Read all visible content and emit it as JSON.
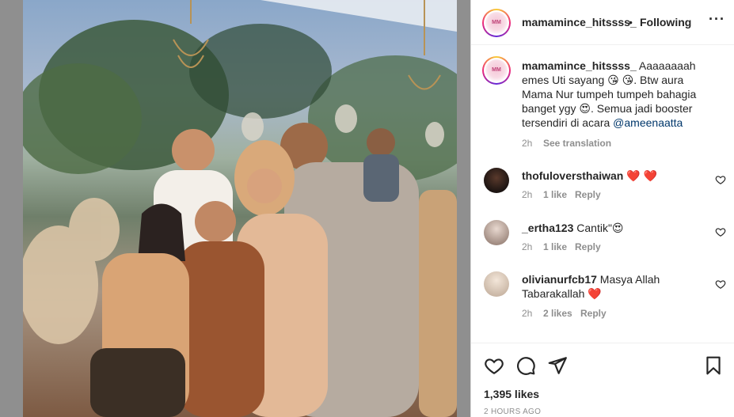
{
  "post": {
    "username": "mamamince_hitssss_",
    "follow_status": "Following",
    "more_icon": "more-horizontal-icon",
    "avatar_text": "MM"
  },
  "caption": {
    "username": "mamamince_hitssss_",
    "text_1": " Aaaaaaaah emes Uti sayang ",
    "emoji_1": "😘 😘",
    "text_2": ". Btw aura Mama Nur tumpeh tumpeh bahagia banget ygy ",
    "emoji_2": "😍",
    "text_3": ". Semua jadi booster tersendiri di acara ",
    "mention": "@ameenaatta",
    "time": "2h",
    "see_translation": "See translation"
  },
  "comments": [
    {
      "username": "thofuloversthaiwan",
      "text": " ❤️ ❤️",
      "time": "2h",
      "likes": "1 like",
      "reply": "Reply"
    },
    {
      "username": "_ertha123",
      "text": " Cantik\"😍",
      "time": "2h",
      "likes": "1 like",
      "reply": "Reply"
    },
    {
      "username": "olivianurfcb17",
      "text": " Masya Allah Tabarakallah ❤️",
      "time": "2h",
      "likes": "2 likes",
      "reply": "Reply"
    }
  ],
  "actions": {
    "like_icon": "heart-icon",
    "comment_icon": "comment-icon",
    "share_icon": "share-icon",
    "save_icon": "bookmark-icon",
    "likes_count": "1,395 likes",
    "timestamp": "2 HOURS AGO"
  },
  "colors": {
    "mention": "#00376b",
    "muted": "#8e8e8e",
    "heart_red": "#ed4956"
  }
}
